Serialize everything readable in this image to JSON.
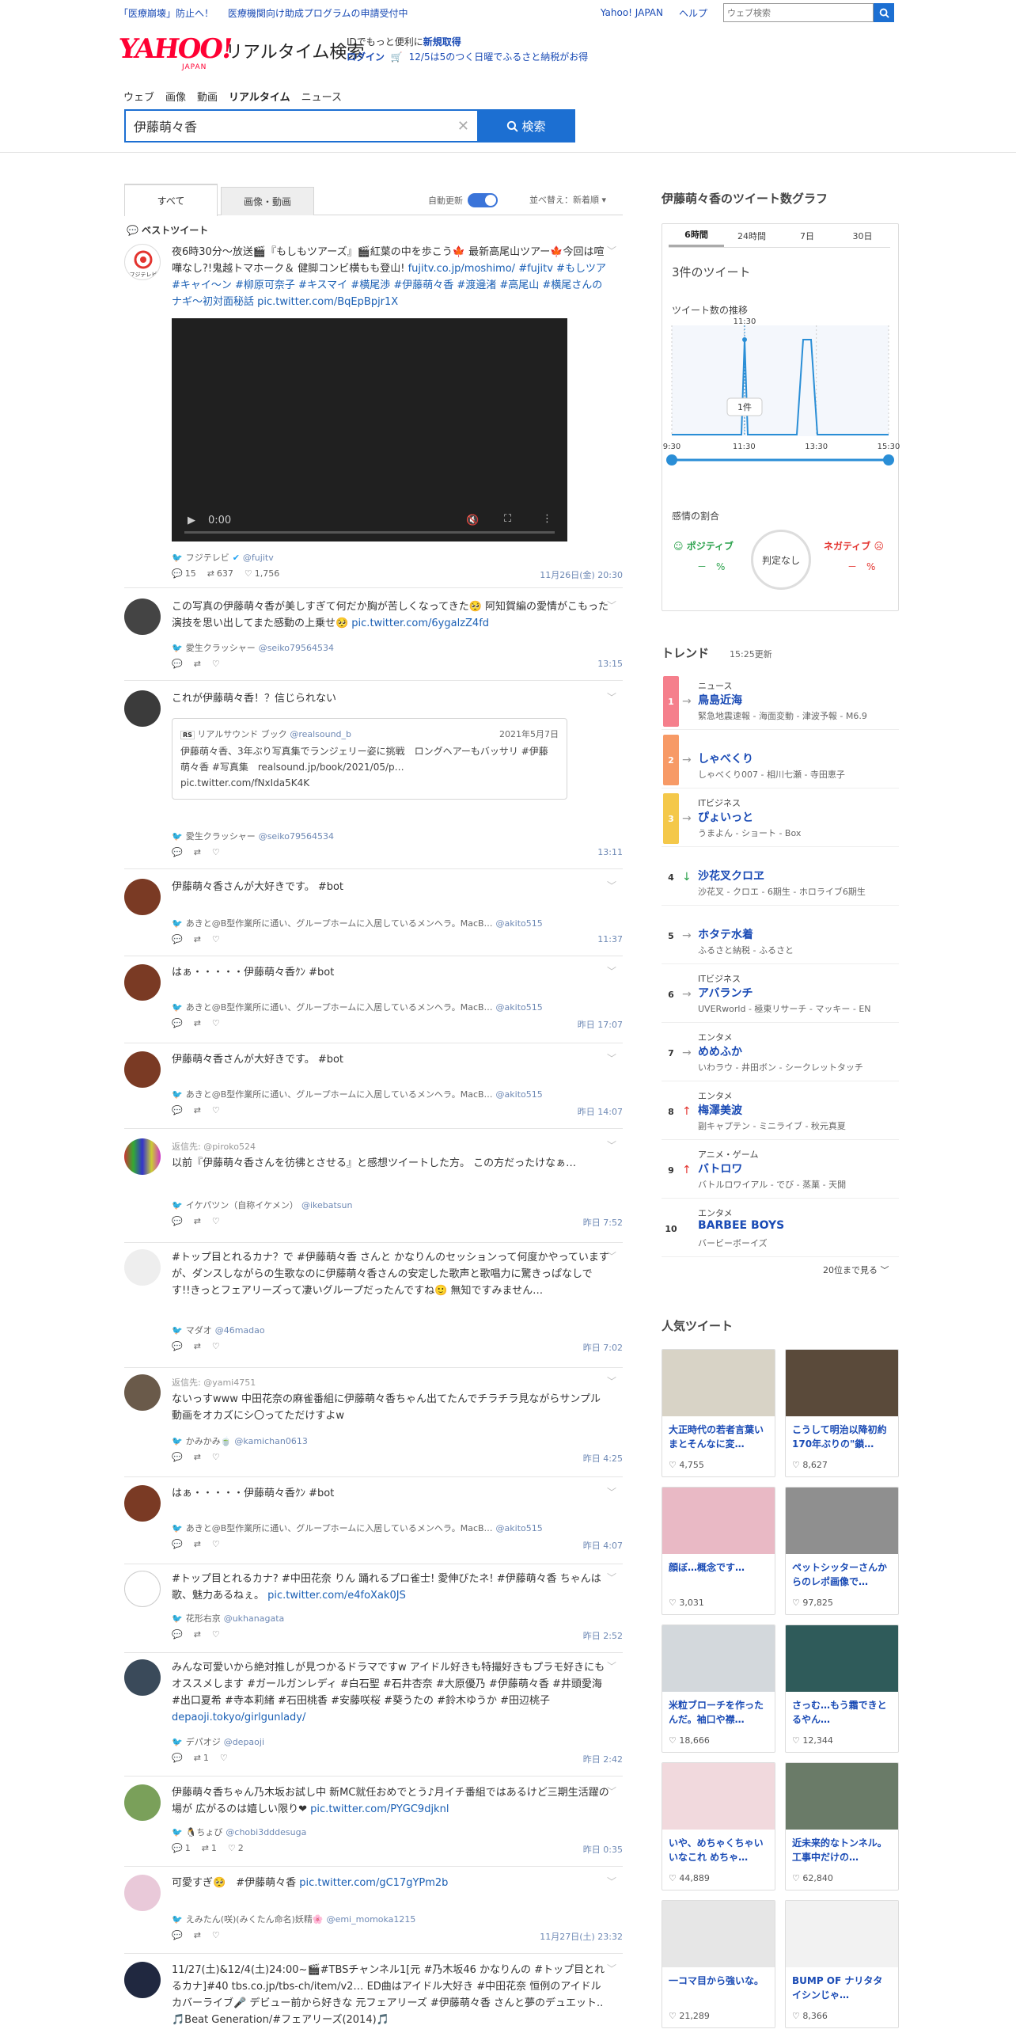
{
  "topbar": {
    "promo1": "「医療崩壊」防止へ！",
    "promo2": "医療機関向け助成プログラムの申請受付中",
    "yahoo_link": "Yahoo! JAPAN",
    "help_link": "ヘルプ",
    "search_placeholder": "ウェブ検索"
  },
  "header": {
    "logo": "YAHOO!",
    "logo_sub": "JAPAN",
    "service": "リアルタイム検索",
    "id_text": "IDでもっと便利に",
    "signup": "新規取得",
    "login": "ログイン",
    "notice": "12/5は5のつく日曜でふるさと納税がお得"
  },
  "nav": [
    "ウェブ",
    "画像",
    "動画",
    "リアルタイム",
    "ニュース"
  ],
  "search": {
    "query": "伊藤萌々香",
    "button": "検索"
  },
  "tabs": {
    "all": "すべて",
    "media": "画像・動画",
    "auto_update": "自動更新",
    "sort": "並べ替え：新着順"
  },
  "best_label": "ベストツイート",
  "tweets": [
    {
      "pre": "夜6時30分〜放送🎬『もしもツアーズ』🎬紅葉の中を歩こう🍁 最新高尾山ツアー🍁今回は喧嘩なし?!鬼越トマホーク＆ 健脚コンビ横もも登山!",
      "link": "fujitv.co.jp/moshimo/",
      "tags": "#fujitv #もしツア #キャイ〜ン #柳原可奈子 #キスマイ #横尾渉 #伊藤萌々香 #渡邊渚 #高尾山 #横尾さんのナギ〜初対面秘話",
      "pic": "pic.twitter.com/BqEpBpjr1X",
      "video_time": "0:00",
      "user": "フジテレビ",
      "screen": "@fujitv",
      "replies": "15",
      "rts": "637",
      "likes": "1,756",
      "time": "11月26日(金) 20:30"
    },
    {
      "text": "この写真の伊藤萌々香が美しすぎて何だか胸が苦しくなってきた🥺 阿知賀編の愛情がこもった演技を思い出してまた感動の上乗せ🥺",
      "link": "pic.twitter.com/6ygalzZ4fd",
      "user": "愛生クラッシャー",
      "screen": "@seiko79564534",
      "time": "13:15"
    },
    {
      "text": "これが伊藤萌々香！？信じられない",
      "q_source": "リアルサウンド ブック",
      "q_screen": "@realsound_b",
      "q_date": "2021年5月7日",
      "q_text": "伊藤萌々香、3年ぶり写真集でランジェリー姿に挑戦　ロングヘアーもバッサリ #伊藤萌々香 #写真集　realsound.jp/book/2021/05/p…",
      "q_link": "pic.twitter.com/fNxIda5K4K",
      "user": "愛生クラッシャー",
      "screen": "@seiko79564534",
      "time": "13:11"
    },
    {
      "text": "伊藤萌々香さんが大好きです。 #bot",
      "user": "あきと@B型作業所に通い、グループホームに入居しているメンヘラ。MacB…",
      "screen": "@akito515",
      "time": "11:37"
    },
    {
      "text": "はぁ・・・・・伊藤萌々香ｸﾝ #bot",
      "user": "あきと@B型作業所に通い、グループホームに入居しているメンヘラ。MacB…",
      "screen": "@akito515",
      "time": "昨日 17:07"
    },
    {
      "text": "伊藤萌々香さんが大好きです。 #bot",
      "user": "あきと@B型作業所に通い、グループホームに入居しているメンヘラ。MacB…",
      "screen": "@akito515",
      "time": "昨日 14:07"
    },
    {
      "reply": "返信先: @piroko524",
      "text": "以前『伊藤萌々香さんを彷彿とさせる』と感想ツイートした方。 この方だったけなぁ…",
      "user": "イケパツン（自称イケメン）",
      "screen": "@ikebatsun",
      "time": "昨日 7:52"
    },
    {
      "text": "#トップ目とれるカナ？で #伊藤萌々香 さんと かなりんのセッションって何度かやっていますが、ダンスしながらの生歌なのに伊藤萌々香さんの安定した歌声と歌唱力に驚きっぱなしです!!きっとフェアリーズって凄いグループだったんですね🙂 無知ですみません…",
      "user": "マダオ",
      "screen": "@46madao",
      "time": "昨日 7:02"
    },
    {
      "reply": "返信先: @yami4751",
      "text": "ないっすwww 中田花奈の麻雀番組に伊藤萌々香ちゃん出てたんでチラチラ見ながらサンプル動画をオカズにシ〇ってただけすよw",
      "user": "かみかみ🍵",
      "screen": "@kamichan0613",
      "time": "昨日 4:25"
    },
    {
      "text": "はぁ・・・・・伊藤萌々香ｸﾝ #bot",
      "user": "あきと@B型作業所に通い、グループホームに入居しているメンヘラ。MacB…",
      "screen": "@akito515",
      "time": "昨日 4:07"
    },
    {
      "text": "#トップ目とれるカナ? #中田花奈 りん 踊れるプロ雀士! 愛伸びたネ! #伊藤萌々香 ちゃんは 歌、魅力あるねぇ。",
      "link": "pic.twitter.com/e4foXak0JS",
      "user": "花形右京",
      "screen": "@ukhanagata",
      "time": "昨日 2:52"
    },
    {
      "text": "みんな可愛いから絶対推しが見つかるドラマですw アイドル好きも特撮好きもプラモ好きにもオススメします #ガールガンレディ #白石聖 #石井杏奈 #大原優乃 #伊藤萌々香 #井頭愛海 #出口夏希 #寺本莉緒 #石田桃香 #安藤咲桜 #葵うたの #鈴木ゆうか #田辺桃子",
      "link": "depaoji.tokyo/girlgunlady/",
      "user": "デパオジ",
      "screen": "@depaoji",
      "rts": "1",
      "time": "昨日 2:42"
    },
    {
      "text": "伊藤萌々香ちゃん乃木坂お試し中 新MC就任おめでとう♪月イチ番組ではあるけど三期生活躍の場が 広がるのは嬉しい限り❤",
      "link": "pic.twitter.com/PYGC9djknl",
      "user": "🐧ちょび",
      "screen": "@chobi3dddesuga",
      "replies": "1",
      "rts": "1",
      "likes": "2",
      "time": "昨日 0:35"
    },
    {
      "text": "可愛すぎ🥺　#伊藤萌々香",
      "link": "pic.twitter.com/gC17gYPm2b",
      "user": "えみたん(咲)(みくたん命名)妖精🌸",
      "screen": "@emi_momoka1215",
      "time": "11月27日(土) 23:32"
    },
    {
      "text": "11/27(土)&12/4(土)24:00~🎬#TBSチャンネル1[元 #乃木坂46 かなりんの #トップ目とれるカナ]#40 tbs.co.jp/tbs-ch/item/v2… ED曲はアイドル大好き #中田花奈 恒例のアイドルカバーライブ🎤 デビュー前から好きな 元フェアリーズ #伊藤萌々香 さんと夢のデュエット.. 🎵Beat Generation/#フェアリーズ(2014)🎵"
    }
  ],
  "graph": {
    "title": "伊藤萌々香のツイート数グラフ",
    "tabs": [
      "6時間",
      "24時間",
      "7日",
      "30日"
    ],
    "count": "3件のツイート",
    "sub": "ツイート数の推移",
    "tooltip_time": "11:30",
    "tooltip_value": "1件",
    "sentiment": "感情の割合",
    "positive": "ポジティブ",
    "negative": "ネガティブ",
    "neutral": "判定なし",
    "pos_val": "－",
    "neg_val": "－",
    "pct": "%"
  },
  "chart_data": {
    "type": "line",
    "x": [
      "9:30",
      "11:30",
      "13:30",
      "15:30"
    ],
    "series": [
      {
        "values": [
          0,
          1,
          0,
          1,
          1,
          0
        ]
      }
    ],
    "ylim": [
      0,
      1
    ]
  },
  "trend": {
    "title": "トレンド",
    "time": "15:25更新",
    "more": "20位まで見る",
    "items": [
      {
        "rank": "1",
        "cat": "ニュース",
        "word": "鳥島近海",
        "rel": "緊急地震速報 - 海面変動 - 津波予報 - M6.9",
        "color": "#f57f8c",
        "arrow": "→",
        "arrow_color": "#999"
      },
      {
        "rank": "2",
        "cat": "",
        "word": "しゃべくり",
        "rel": "しゃべくり007 - 相川七瀬 - 寺田恵子",
        "color": "#f79a66",
        "arrow": "→",
        "arrow_color": "#999"
      },
      {
        "rank": "3",
        "cat": "ITビジネス",
        "word": "ぴょいっと",
        "rel": "うまよん - ショート - Box",
        "color": "#f4c84a",
        "arrow": "→",
        "arrow_color": "#999"
      },
      {
        "rank": "4",
        "cat": "",
        "word": "沙花叉クロヱ",
        "rel": "沙花叉 - クロエ - 6期生 - ホロライブ6期生",
        "color": "#fff",
        "arrow": "↓",
        "arrow_color": "#2aa14b"
      },
      {
        "rank": "5",
        "cat": "",
        "word": "ホタテ水着",
        "rel": "ふるさと納税 - ふるさと",
        "color": "#fff",
        "arrow": "→",
        "arrow_color": "#999"
      },
      {
        "rank": "6",
        "cat": "ITビジネス",
        "word": "アバランチ",
        "rel": "UVERworld - 極東リサーチ - マッキー - EN",
        "color": "#fff",
        "arrow": "→",
        "arrow_color": "#999"
      },
      {
        "rank": "7",
        "cat": "エンタメ",
        "word": "めめふか",
        "rel": "いわラウ - 井田ボン - シークレットタッチ",
        "color": "#fff",
        "arrow": "→",
        "arrow_color": "#999"
      },
      {
        "rank": "8",
        "cat": "エンタメ",
        "word": "梅澤美波",
        "rel": "副キャプテン - ミニライブ - 秋元真夏",
        "color": "#fff",
        "arrow": "↑",
        "arrow_color": "#e3342f"
      },
      {
        "rank": "9",
        "cat": "アニメ・ゲーム",
        "word": "バトロワ",
        "rel": "バトルロワイアル - でび - 蒸菓 - 天開",
        "color": "#fff",
        "arrow": "↑",
        "arrow_color": "#e3342f"
      },
      {
        "rank": "10",
        "cat": "エンタメ",
        "word": "BARBEE BOYS",
        "rel": "バービーボーイズ",
        "color": "#fff",
        "arrow": "",
        "arrow_color": "#999"
      }
    ]
  },
  "popular": {
    "title": "人気ツイート",
    "items": [
      {
        "text": "大正時代の若者言葉いまとそんなに変…",
        "likes": "4,755",
        "bg": "#d8d3c6"
      },
      {
        "text": "こうして明治以降初約170年ぶりの\"鎖…",
        "likes": "8,627",
        "bg": "#5a4a3a"
      },
      {
        "text": "顔ぼ…概念です…",
        "likes": "3,031",
        "bg": "#e9b9c5"
      },
      {
        "text": "ペットシッターさんからのレポ画像で…",
        "likes": "97,825",
        "bg": "#8f8f8f"
      },
      {
        "text": "米粒ブローチを作ったんだ。袖口や襟…",
        "likes": "18,666",
        "bg": "#d3d8dc"
      },
      {
        "text": "さっむ…もう霜できとるやん…",
        "likes": "12,344",
        "bg": "#2f5b5a"
      },
      {
        "text": "いや、めちゃくちゃいいなこれ めちゃ…",
        "likes": "44,889",
        "bg": "#f1d9dd"
      },
      {
        "text": "近未来的なトンネル。工事中だけの…",
        "likes": "62,840",
        "bg": "#6a7b68"
      },
      {
        "text": "一コマ目から強いな。",
        "likes": "21,289",
        "bg": "#e6e6e6"
      },
      {
        "text": "BUMP OF ナリタタイシンじゃ…",
        "likes": "8,366",
        "bg": "#f2f2f2"
      }
    ]
  },
  "colors": {
    "accent": "#1c6fd2",
    "link": "#1a5fb4",
    "logo": "#ff0033"
  }
}
